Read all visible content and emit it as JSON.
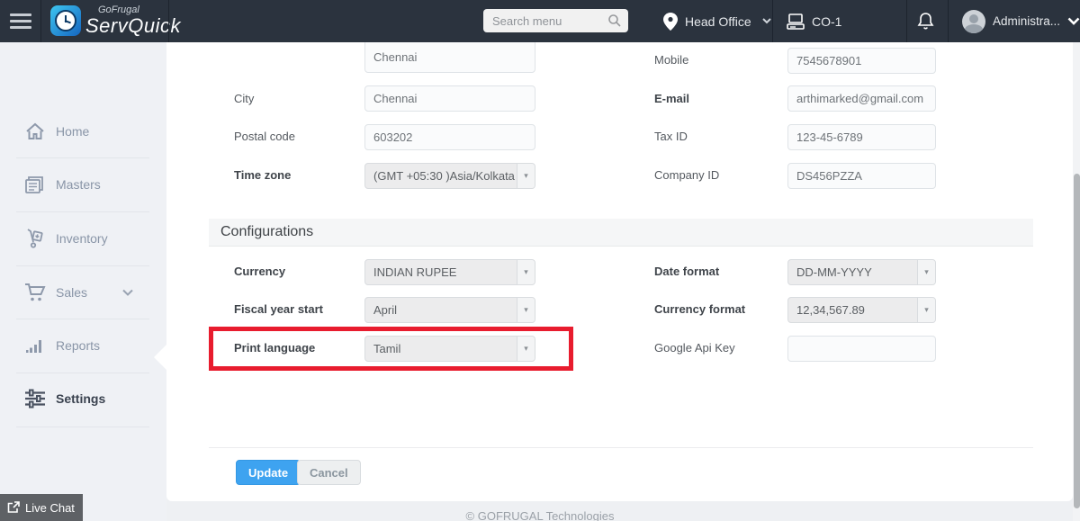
{
  "header": {
    "logo": {
      "brand_small": "GoFrugal",
      "brand_large": "ServQuick"
    },
    "search": {
      "placeholder": "Search menu"
    },
    "location": {
      "label": "Head Office"
    },
    "terminal": {
      "label": "CO-1"
    },
    "user": {
      "label": "Administra..."
    }
  },
  "sidebar": {
    "items": [
      {
        "label": "Home"
      },
      {
        "label": "Masters"
      },
      {
        "label": "Inventory"
      },
      {
        "label": "Sales"
      },
      {
        "label": "Reports"
      },
      {
        "label": "Settings"
      }
    ],
    "active_item": "Settings",
    "live_chat_label": "Live Chat"
  },
  "form": {
    "top_partial_value": "Chennai",
    "left_fields": [
      {
        "label": "City",
        "value": "Chennai",
        "type": "input"
      },
      {
        "label": "Postal code",
        "value": "603202",
        "type": "input"
      },
      {
        "label": "Time zone",
        "value": "(GMT +05:30 )Asia/Kolkata",
        "type": "select"
      }
    ],
    "right_fields": [
      {
        "label": "Mobile",
        "value": "7545678901",
        "type": "input"
      },
      {
        "label": "E-mail",
        "value": "arthimarked@gmail.com",
        "type": "input"
      },
      {
        "label": "Tax ID",
        "value": "123-45-6789",
        "type": "input"
      },
      {
        "label": "Company ID",
        "value": "DS456PZZA",
        "type": "input"
      }
    ]
  },
  "configurations": {
    "title": "Configurations",
    "left_fields": [
      {
        "label": "Currency",
        "value": "INDIAN RUPEE",
        "type": "select"
      },
      {
        "label": "Fiscal year start",
        "value": "April",
        "type": "select"
      },
      {
        "label": "Print language",
        "value": "Tamil",
        "type": "select",
        "highlighted": true
      }
    ],
    "right_fields": [
      {
        "label": "Date format",
        "value": "DD-MM-YYYY",
        "type": "select"
      },
      {
        "label": "Currency format",
        "value": "12,34,567.89",
        "type": "select"
      },
      {
        "label": "Google Api Key",
        "value": "",
        "type": "input"
      }
    ]
  },
  "actions": {
    "update_label": "Update",
    "cancel_label": "Cancel"
  },
  "footer": {
    "copyright": "© GOFRUGAL Technologies"
  },
  "icons": {
    "select_caret": "▾",
    "header_caret": "▾"
  },
  "colors": {
    "header_bg": "#2b333e",
    "accent_blue": "#3ea3f0",
    "annotation_red": "#e81c2e",
    "sidebar_bg": "#eff1f5"
  }
}
